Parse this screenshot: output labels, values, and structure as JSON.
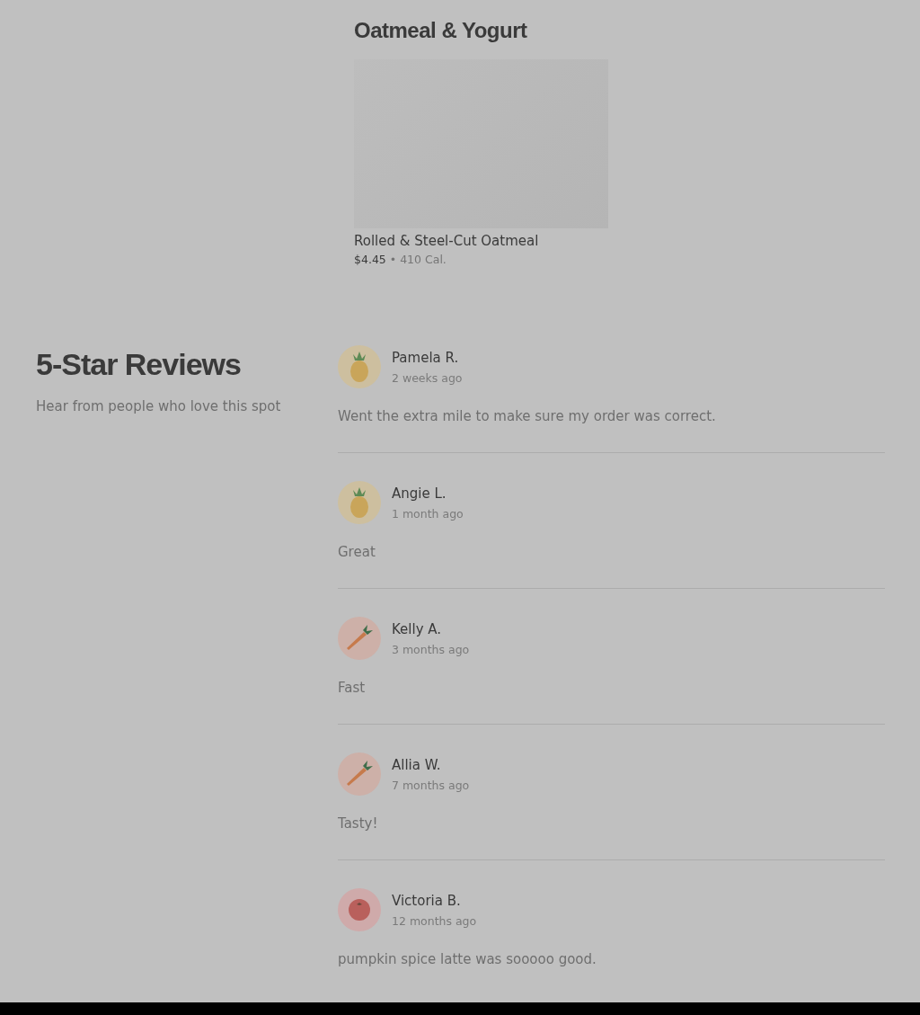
{
  "menu_section": {
    "title": "Oatmeal & Yogurt",
    "item": {
      "name": "Rolled & Steel-Cut Oatmeal",
      "price": "$4.45",
      "separator": "•",
      "calories": "410 Cal."
    }
  },
  "reviews_section": {
    "title": "5-Star Reviews",
    "subtitle": "Hear from people who love this spot"
  },
  "reviews": [
    {
      "name": "Pamela R.",
      "time": "2 weeks ago",
      "text": "Went the extra mile to make sure my order was correct.",
      "kind": "pineapple"
    },
    {
      "name": "Angie L.",
      "time": "1 month ago",
      "text": "Great",
      "kind": "pineapple"
    },
    {
      "name": "Kelly A.",
      "time": "3 months ago",
      "text": "Fast",
      "kind": "carrot"
    },
    {
      "name": "Allia W.",
      "time": "7 months ago",
      "text": "Tasty!",
      "kind": "carrot"
    },
    {
      "name": "Victoria B.",
      "time": "12 months ago",
      "text": "pumpkin spice latte was sooooo good.",
      "kind": "tomato"
    }
  ]
}
